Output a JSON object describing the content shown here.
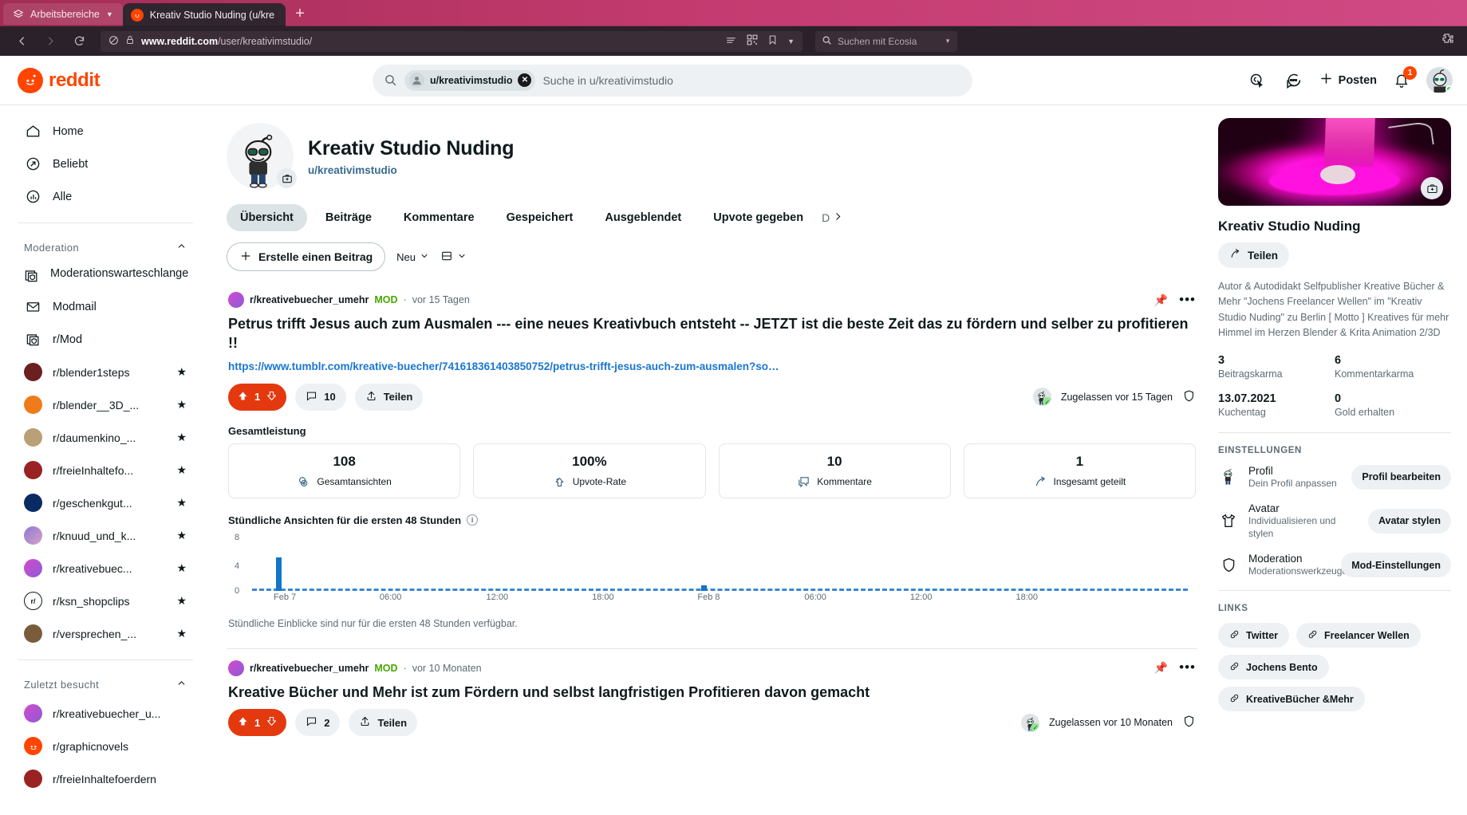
{
  "browser": {
    "workspaces_label": "Arbeitsbereiche",
    "tab_title": "Kreativ Studio Nuding (u/kre",
    "newtab_label": "+",
    "url_prefix": "www.reddit.com",
    "url_suffix": "/user/kreativimstudio/",
    "search_placeholder": "Suchen mit Ecosia",
    "icons": {
      "back": "back-arrow-icon",
      "forward": "forward-arrow-icon",
      "reload": "reload-icon",
      "shield": "tracking-protection-icon",
      "lock": "lock-icon",
      "reader": "reader-view-icon",
      "qr": "qr-code-icon",
      "bookmark": "bookmark-icon",
      "extensions": "extensions-icon"
    }
  },
  "reddit_header": {
    "logo_text": "reddit",
    "search_chip": "u/kreativimstudio",
    "search_placeholder": "Suche in u/kreativimstudio",
    "post_label": "Posten",
    "notification_count": "1"
  },
  "sidebar": {
    "primary": [
      {
        "label": "Home",
        "icon": "home-icon"
      },
      {
        "label": "Beliebt",
        "icon": "popular-icon"
      },
      {
        "label": "Alle",
        "icon": "all-icon"
      }
    ],
    "moderation": {
      "title": "Moderation",
      "items": [
        {
          "label": "Moderationswarteschlange",
          "icon": "mod-queue-icon"
        },
        {
          "label": "Modmail",
          "icon": "modmail-icon"
        },
        {
          "label": "r/Mod",
          "icon": "mod-shield-icon"
        }
      ],
      "communities": [
        {
          "label": "r/blender1steps",
          "color": "#6b1f1f",
          "starred": true
        },
        {
          "label": "r/blender__3D_...",
          "color": "#f07b1a",
          "starred": true
        },
        {
          "label": "r/daumenkino_...",
          "color": "#b9a076",
          "starred": true
        },
        {
          "label": "r/freieInhaltefo...",
          "color": "#9b2222",
          "starred": true
        },
        {
          "label": "r/geschenkgut...",
          "color": "#0a2a63",
          "starred": true
        },
        {
          "label": "r/knuud_und_k...",
          "color": "#7e6ab5",
          "starred": true
        },
        {
          "label": "r/kreativebuec...",
          "color": "#c14bd1",
          "starred": true
        },
        {
          "label": "r/ksn_shopclips",
          "color": "#ffffff",
          "starred": true
        },
        {
          "label": "r/versprechen_...",
          "color": "#7a5c3a",
          "starred": true
        }
      ]
    },
    "recent": {
      "title": "Zuletzt besucht",
      "items": [
        {
          "label": "r/kreativebuecher_u...",
          "color": "#c14bd1"
        },
        {
          "label": "r/graphicnovels",
          "color": "#ff4500"
        },
        {
          "label": "r/freieInhaltefoerdern",
          "color": "#9b2222"
        }
      ]
    }
  },
  "profile": {
    "display_name": "Kreativ Studio Nuding",
    "handle": "u/kreativimstudio",
    "tabs": [
      "Übersicht",
      "Beiträge",
      "Kommentare",
      "Gespeichert",
      "Ausgeblendet",
      "Upvote gegeben",
      "D"
    ],
    "active_tab": "Übersicht",
    "create_post_label": "Erstelle einen Beitrag",
    "sort_label": "Neu",
    "view_label": "view-layout"
  },
  "posts": [
    {
      "subreddit": "r/kreativebuecher_umehr",
      "mod_tag": "MOD",
      "time": "vor 15 Tagen",
      "title": "Petrus trifft Jesus auch zum Ausmalen --- eine neues Kreativbuch entsteht -- JETZT ist die beste Zeit das zu fördern und selber zu profitieren !!",
      "link": "https://www.tumblr.com/kreative-buecher/741618361403850752/petrus-trifft-jesus-auch-zum-ausmalen?so…",
      "votes": "1",
      "comments": "10",
      "share_label": "Teilen",
      "approved": "Zugelassen vor 15 Tagen",
      "insights": {
        "section_label": "Gesamtleistung",
        "cards": [
          {
            "value": "108",
            "label": "Gesamtansichten",
            "icon": "views-icon"
          },
          {
            "value": "100%",
            "label": "Upvote-Rate",
            "icon": "upvote-rate-icon"
          },
          {
            "value": "10",
            "label": "Kommentare",
            "icon": "comments-icon"
          },
          {
            "value": "1",
            "label": "Insgesamt geteilt",
            "icon": "share-icon"
          }
        ],
        "chart_title": "Stündliche Ansichten für die ersten 48 Stunden",
        "chart_note": "Stündliche Einblicke sind nur für die ersten 48 Stunden verfügbar."
      }
    },
    {
      "subreddit": "r/kreativebuecher_umehr",
      "mod_tag": "MOD",
      "time": "vor 10 Monaten",
      "title": "Kreative Bücher und Mehr ist zum Fördern und selbst langfristigen Profitieren davon gemacht",
      "votes": "1",
      "comments": "2",
      "share_label": "Teilen",
      "approved": "Zugelassen vor 10 Monaten"
    }
  ],
  "chart_data": {
    "type": "bar",
    "title": "Stündliche Ansichten für die ersten 48 Stunden",
    "xlabel": "",
    "ylabel": "",
    "ylim": [
      0,
      8
    ],
    "yticks": [
      0,
      4,
      8
    ],
    "ytick_labels": [
      "0",
      "4",
      "8"
    ],
    "xtick_labels": [
      "Feb 7",
      "06:00",
      "12:00",
      "18:00",
      "Feb 8",
      "06:00",
      "12:00",
      "18:00"
    ],
    "xtick_positions_pct": [
      3.5,
      14.8,
      26.2,
      37.5,
      48.8,
      60.2,
      71.5,
      82.8
    ],
    "grid": false,
    "legend": "none",
    "bar_color": "#1275c8",
    "x": [
      "Feb 7 00:00",
      "Feb 7 21:00"
    ],
    "values": [
      4.5,
      0.6
    ],
    "bars_pct": [
      {
        "x_pct": 2.6,
        "value": 4.5
      },
      {
        "x_pct": 48.0,
        "value": 0.6
      }
    ]
  },
  "rightbar": {
    "banner_alt": "profile-banner",
    "name": "Kreativ Studio Nuding",
    "share_label": "Teilen",
    "description": "Autor & Autodidakt Selfpublisher Kreative Bücher & Mehr \"Jochens Freelancer Wellen\" im \"Kreativ Studio Nuding\" zu Berlin [ Motto ] Kreatives für mehr Himmel im Herzen Blender & Krita Animation 2/3D",
    "karma": [
      {
        "value": "3",
        "label": "Beitragskarma"
      },
      {
        "value": "6",
        "label": "Kommentarkarma"
      },
      {
        "value": "13.07.2021",
        "label": "Kuchentag"
      },
      {
        "value": "0",
        "label": "Gold erhalten"
      }
    ],
    "settings_title": "EINSTELLUNGEN",
    "settings": [
      {
        "title": "Profil",
        "sub": "Dein Profil anpassen",
        "button": "Profil bearbeiten",
        "icon": "profile-avatar-icon"
      },
      {
        "title": "Avatar",
        "sub": "Individualisieren und stylen",
        "button": "Avatar stylen",
        "icon": "tshirt-icon"
      },
      {
        "title": "Moderation",
        "sub": "Moderationswerkzeuge",
        "button": "Mod-Einstellungen",
        "icon": "shield-icon"
      }
    ],
    "links_title": "LINKS",
    "links": [
      "Twitter",
      "Freelancer Wellen",
      "Jochens Bento",
      "KreativeBücher &Mehr"
    ]
  },
  "colors": {
    "reddit_orange": "#ff4500",
    "upvote_red": "#e4390f",
    "chart_blue": "#1275c8",
    "link_blue": "#1976d2",
    "mod_green": "#46a800"
  }
}
